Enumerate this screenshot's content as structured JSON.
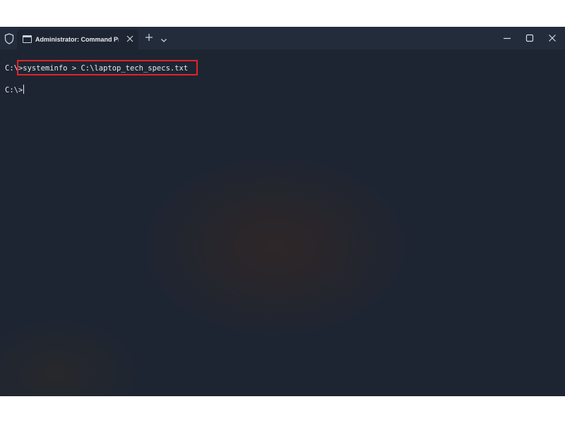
{
  "window": {
    "tab_title": "Administrator: Command Pro",
    "icons": {
      "shield": "shield-icon",
      "terminal": "terminal-icon",
      "close_tab": "close-icon",
      "new_tab": "plus-icon",
      "dropdown": "chevron-down-icon",
      "minimize": "minimize-icon",
      "maximize": "maximize-icon",
      "close_window": "close-icon"
    }
  },
  "terminal": {
    "prompt1": "C:\\",
    "command1": ">systeminfo > C:\\laptop_tech_specs.txt",
    "prompt2": "C:\\>"
  },
  "colors": {
    "background": "#1e2532",
    "titlebar": "#232c3a",
    "text": "#e6e9ee",
    "highlight_border": "#e0242b"
  }
}
